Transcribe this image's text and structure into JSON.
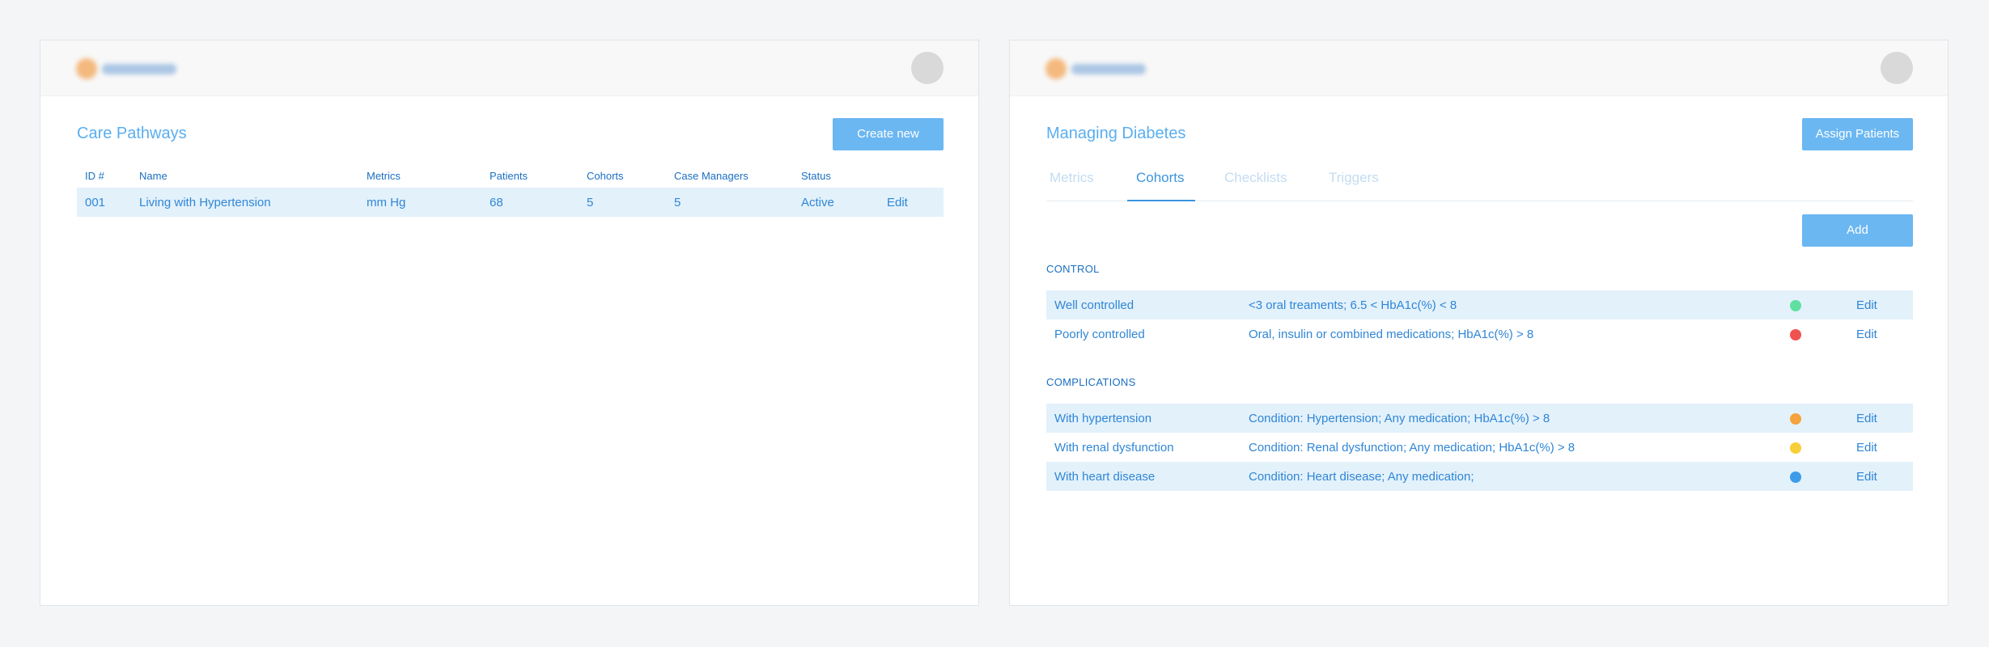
{
  "left": {
    "title": "Care Pathways",
    "create_label": "Create new",
    "columns": [
      "ID #",
      "Name",
      "Metrics",
      "Patients",
      "Cohorts",
      "Case Managers",
      "Status"
    ],
    "rows": [
      {
        "id": "001",
        "name": "Living with Hypertension",
        "metrics": "mm Hg",
        "patients": "68",
        "cohorts": "5",
        "case_managers": "5",
        "status": "Active",
        "edit": "Edit"
      }
    ]
  },
  "right": {
    "title": "Managing Diabetes",
    "assign_label": "Assign Patients",
    "tabs": [
      "Metrics",
      "Cohorts",
      "Checklists",
      "Triggers"
    ],
    "active_tab": "Cohorts",
    "add_label": "Add",
    "sections": [
      {
        "label": "CONTROL",
        "rows": [
          {
            "name": "Well controlled",
            "criteria": "<3 oral treaments; 6.5 < HbA1c(%) < 8",
            "color": "#5fe0a0",
            "edit": "Edit"
          },
          {
            "name": "Poorly controlled",
            "criteria": "Oral, insulin or combined medications; HbA1c(%) > 8",
            "color": "#f0524f",
            "edit": "Edit"
          }
        ]
      },
      {
        "label": "COMPLICATIONS",
        "rows": [
          {
            "name": "With hypertension",
            "criteria": "Condition: Hypertension; Any medication; HbA1c(%) > 8",
            "color": "#f5a33c",
            "edit": "Edit"
          },
          {
            "name": "With renal dysfunction",
            "criteria": "Condition: Renal dysfunction; Any medication; HbA1c(%) > 8",
            "color": "#f7cf3a",
            "edit": "Edit"
          },
          {
            "name": "With heart disease",
            "criteria": "Condition: Heart disease; Any medication;",
            "color": "#3d9be9",
            "edit": "Edit"
          }
        ]
      }
    ]
  },
  "colors": {
    "accent": "#5aaef0",
    "button": "#6bb7f2",
    "row_highlight": "#e3f1fb",
    "text": "#2f86d6"
  }
}
